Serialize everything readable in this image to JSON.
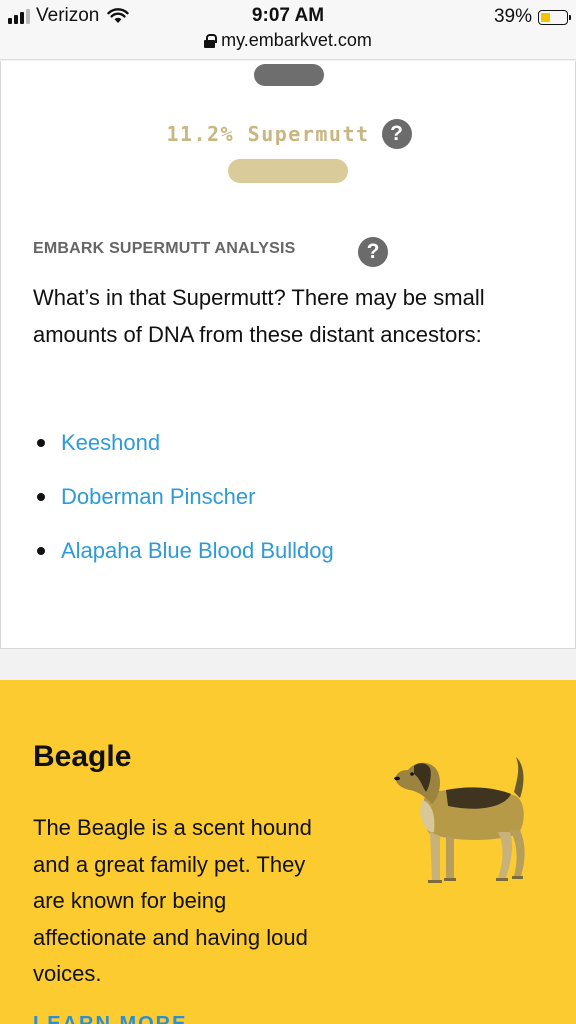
{
  "status_bar": {
    "carrier": "Verizon",
    "time": "9:07 AM",
    "url": "my.embarkvet.com",
    "battery": "39%",
    "battery_level": 0.39,
    "battery_color": "#f5c400"
  },
  "supermutt": {
    "label": "11.2% Supermutt",
    "percent": 11.2,
    "help_icon": "question-circle-icon"
  },
  "analysis": {
    "title": "EMBARK SUPERMUTT ANALYSIS",
    "help_icon": "question-circle-icon",
    "description": "What’s in that Supermutt? There may be small amounts of DNA from these distant ancestors:",
    "ancestors": [
      "Keeshond",
      "Doberman Pinscher",
      "Alapaha Blue Blood Bulldog"
    ],
    "link_color": "#2e9bd6"
  },
  "breed_card": {
    "title": "Beagle",
    "description": "The Beagle is a scent hound and a great family pet. They are known for being affectionate and having loud voices.",
    "learn_more": "LEARN MORE",
    "background": "#fccb2f",
    "image_icon": "beagle-illustration"
  }
}
